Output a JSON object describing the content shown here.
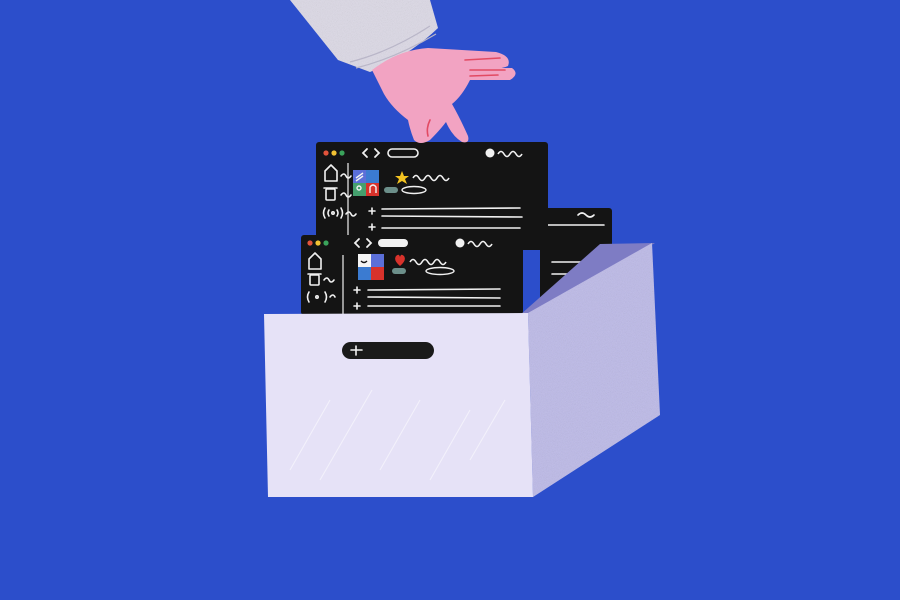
{
  "scene": {
    "background_color": "#2c4ecb",
    "box": {
      "front_color": "#e6e2f7",
      "side_color": "#bcb9e8",
      "inner_color": "#7e7cc4",
      "handle_color": "#1a1a1a"
    },
    "hand": {
      "skin_color": "#f2a3c2",
      "sleeve_color": "#dcd9e6",
      "line_color": "#e24a63"
    },
    "windows": {
      "panel_color": "#141414",
      "chalk_color": "#f1f1f1",
      "traffic_lights": [
        "#e2533b",
        "#f2c233",
        "#3aa35b"
      ],
      "accent_colors": [
        "#5b6fd8",
        "#45a06e",
        "#3b7bd1",
        "#f3c321",
        "#d8322b",
        "#6c8f8a"
      ],
      "icons": [
        "home-icon",
        "trash-icon",
        "broadcast-icon",
        "plus-icon",
        "heart-icon",
        "star-icon",
        "back-forward-icon"
      ]
    }
  }
}
